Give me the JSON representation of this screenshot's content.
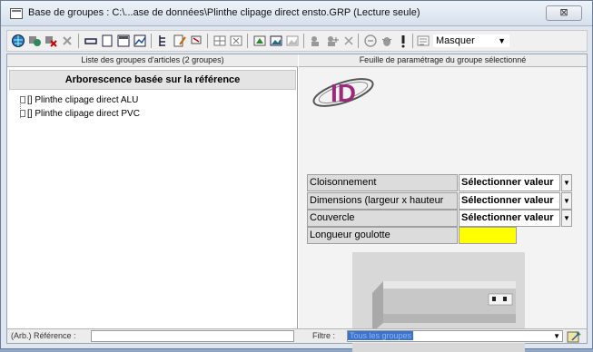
{
  "window": {
    "title": "Base de groupes : C:\\...ase de données\\Plinthe clipage direct ensto.GRP (Lecture seule)",
    "close_symbol": "⊠"
  },
  "toolbar": {
    "display_mode_value": "Masquer",
    "dropdown_symbol": "▼"
  },
  "left_pane": {
    "header": "Liste des groupes d'articles (2 groupes)",
    "tree_title": "Arborescence basée sur la référence",
    "items": [
      {
        "label": "[] Plinthe clipage direct ALU"
      },
      {
        "label": "[] Plinthe clipage direct PVC"
      }
    ]
  },
  "right_pane": {
    "header": "Feuille de paramétrage du groupe sélectionné",
    "logo_text": "ID",
    "params": [
      {
        "label": "Cloisonnement",
        "value": "Sélectionner valeur",
        "arrow": "▼"
      },
      {
        "label": "Dimensions (largeur x hauteur mm)",
        "value": "Sélectionner valeur",
        "arrow": "▼"
      },
      {
        "label": "Couvercle",
        "value": "Sélectionner valeur",
        "arrow": "▼"
      },
      {
        "label": "Longueur goulotte"
      }
    ],
    "highlight_color": "#ffff00"
  },
  "bottom_bar": {
    "reference_label": "(Arb.) Référence :",
    "reference_value": "",
    "filter_label": "Filtre :",
    "filter_value": "Tous les groupes",
    "dropdown_symbol": "▼"
  },
  "icons": [
    "app-window-icon",
    "globe-icon",
    "tools-icon",
    "delete-icon",
    "minimize-icon",
    "window-icon",
    "table-icon",
    "chart-icon",
    "tree-icon",
    "edit-icon",
    "flag-icon",
    "grid-icon",
    "export-icon",
    "image-icon",
    "users-icon",
    "close-x-icon",
    "bug-icon",
    "exclamation-icon",
    "sort-icon",
    "wizard-icon"
  ]
}
